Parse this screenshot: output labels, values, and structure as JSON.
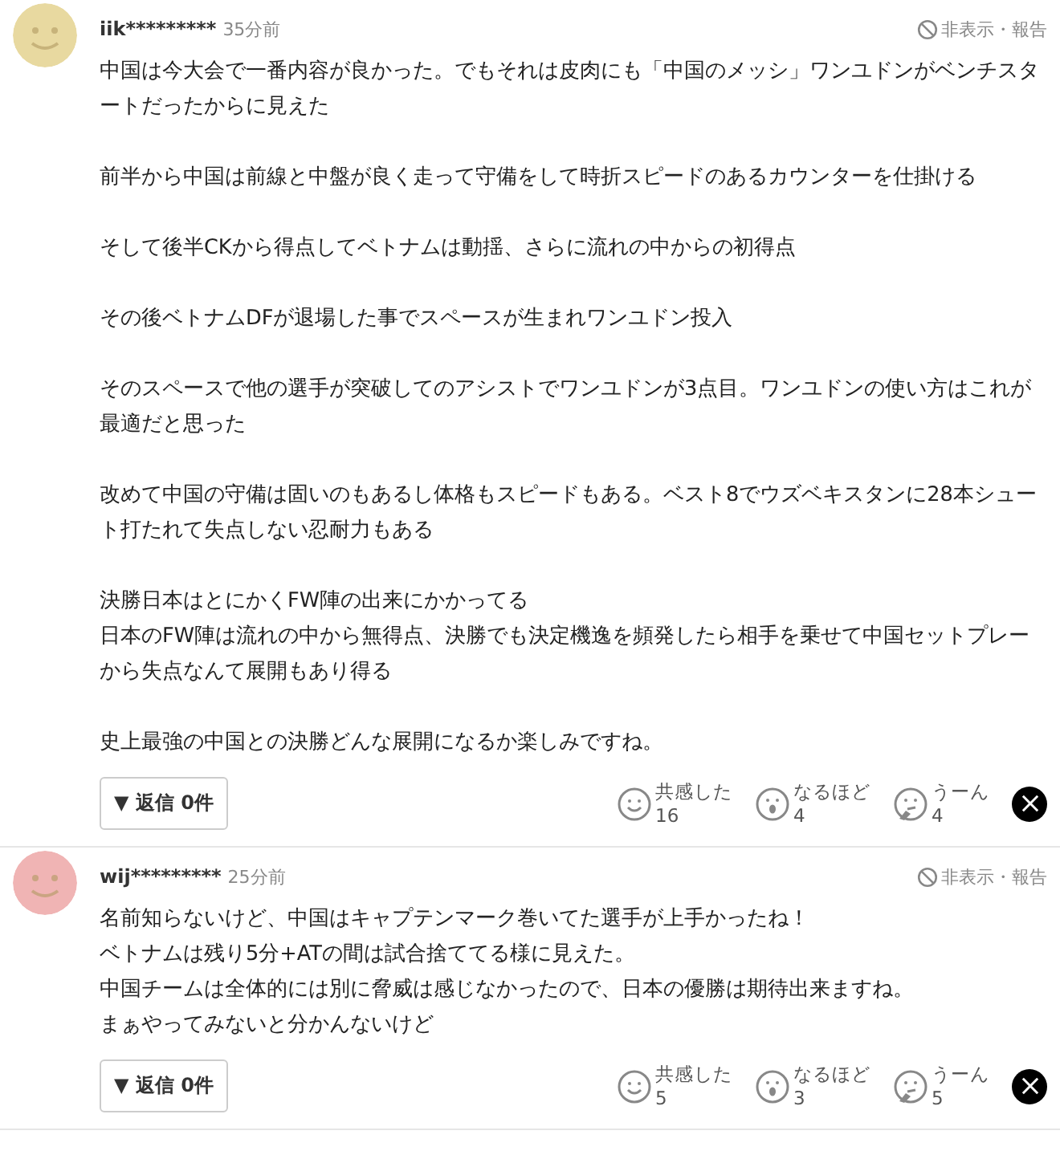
{
  "comments": [
    {
      "user": "iik*********",
      "time": "35分前",
      "color": "#e8d9a0",
      "report": "非表示・報告",
      "paragraphs": [
        [
          "中国は今大会で一番内容が良かった。でもそれは皮肉にも「中国のメッシ」ワンユドンがベンチスタートだったからに見えた"
        ],
        [
          "前半から中国は前線と中盤が良く走って守備をして時折スピードのあるカウンターを仕掛ける"
        ],
        [
          "そして後半CKから得点してベトナムは動揺、さらに流れの中からの初得点"
        ],
        [
          "その後ベトナムDFが退場した事でスペースが生まれワンユドン投入"
        ],
        [
          "そのスペースで他の選手が突破してのアシストでワンユドンが3点目。ワンユドンの使い方はこれが最適だと思った"
        ],
        [
          "改めて中国の守備は固いのもあるし体格もスピードもある。ベスト8でウズベキスタンに28本シュート打たれて失点しない忍耐力もある"
        ],
        [
          "決勝日本はとにかくFW陣の出来にかかってる",
          "日本のFW陣は流れの中から無得点、決勝でも決定機逸を頻発したら相手を乗せて中国セットプレーから失点なんて展開もあり得る"
        ],
        [
          "史上最強の中国との決勝どんな展開になるか楽しみですね。"
        ]
      ],
      "reply_button": "▼ 返信 0件",
      "reactions": [
        {
          "kind": "smile",
          "label": "共感した",
          "count": "16"
        },
        {
          "kind": "surprise",
          "label": "なるほど",
          "count": "4"
        },
        {
          "kind": "think",
          "label": "うーん",
          "count": "4"
        }
      ]
    },
    {
      "user": "wij*********",
      "time": "25分前",
      "color": "#f0b4b4",
      "report": "非表示・報告",
      "paragraphs": [
        [
          "名前知らないけど、中国はキャプテンマーク巻いてた選手が上手かったね！",
          "ベトナムは残り5分+ATの間は試合捨ててる様に見えた。",
          "中国チームは全体的には別に脅威は感じなかったので、日本の優勝は期待出来ますね。",
          "まぁやってみないと分かんないけど"
        ]
      ],
      "reply_button": "▼ 返信 0件",
      "reactions": [
        {
          "kind": "smile",
          "label": "共感した",
          "count": "5"
        },
        {
          "kind": "surprise",
          "label": "なるほど",
          "count": "3"
        },
        {
          "kind": "think",
          "label": "うーん",
          "count": "5"
        }
      ]
    }
  ]
}
